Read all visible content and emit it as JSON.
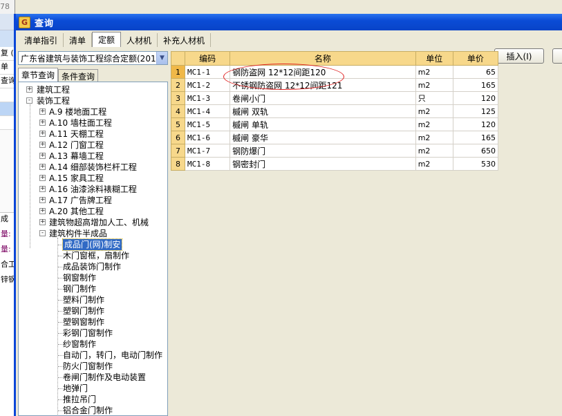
{
  "background_app": {
    "title_fragment": "78",
    "toolbar_fragment": "单",
    "left_fragment": "复 (D)",
    "row_label": "查询",
    "section_label": "成",
    "labels": [
      "量:",
      "量:",
      "合工",
      "锌钢"
    ]
  },
  "window": {
    "title": "查询",
    "icon_glyph": "G"
  },
  "tabs": [
    {
      "label": "清单指引",
      "active": false
    },
    {
      "label": "清单",
      "active": false
    },
    {
      "label": "定额",
      "active": true
    },
    {
      "label": "人材机",
      "active": false
    },
    {
      "label": "补充人材机",
      "active": false
    }
  ],
  "buttons": {
    "insert": "插入(I)"
  },
  "quota_library": {
    "selected": "广东省建筑与装饰工程综合定额(201"
  },
  "subtabs": [
    {
      "label": "章节查询",
      "active": true
    },
    {
      "label": "条件查询",
      "active": false
    }
  ],
  "tree": [
    {
      "label": "建筑工程",
      "level": 0,
      "expander": "+"
    },
    {
      "label": "装饰工程",
      "level": 0,
      "expander": "-"
    },
    {
      "label": "A.9 楼地面工程",
      "level": 1,
      "expander": "+"
    },
    {
      "label": "A.10 墙柱面工程",
      "level": 1,
      "expander": "+"
    },
    {
      "label": "A.11 天棚工程",
      "level": 1,
      "expander": "+"
    },
    {
      "label": "A.12 门窗工程",
      "level": 1,
      "expander": "+"
    },
    {
      "label": "A.13 幕墙工程",
      "level": 1,
      "expander": "+"
    },
    {
      "label": "A.14 细部装饰栏杆工程",
      "level": 1,
      "expander": "+"
    },
    {
      "label": "A.15 家具工程",
      "level": 1,
      "expander": "+"
    },
    {
      "label": "A.16 油漆涂料裱糊工程",
      "level": 1,
      "expander": "+"
    },
    {
      "label": "A.17 广告牌工程",
      "level": 1,
      "expander": "+"
    },
    {
      "label": "A.20 其他工程",
      "level": 1,
      "expander": "+"
    },
    {
      "label": "建筑物超高增加人工、机械",
      "level": 1,
      "expander": "+"
    },
    {
      "label": "建筑构件半成品",
      "level": 1,
      "expander": "-"
    },
    {
      "label": "成品门(网)制安",
      "level": 2,
      "selected": true
    },
    {
      "label": "木门窗框，扇制作",
      "level": 2
    },
    {
      "label": "成品装饰门制作",
      "level": 2
    },
    {
      "label": "钢窗制作",
      "level": 2
    },
    {
      "label": "钢门制作",
      "level": 2
    },
    {
      "label": "塑料门制作",
      "level": 2
    },
    {
      "label": "塑钢门制作",
      "level": 2
    },
    {
      "label": "塑钢窗制作",
      "level": 2
    },
    {
      "label": "彩钢门窗制作",
      "level": 2
    },
    {
      "label": "纱窗制作",
      "level": 2
    },
    {
      "label": "自动门，转门，电动门制作",
      "level": 2
    },
    {
      "label": "防火门窗制作",
      "level": 2
    },
    {
      "label": "卷闸门制作及电动装置",
      "level": 2
    },
    {
      "label": "地弹门",
      "level": 2
    },
    {
      "label": "推拉吊门",
      "level": 2
    },
    {
      "label": "铝合金门制作",
      "level": 2
    }
  ],
  "grid": {
    "columns": [
      "编码",
      "名称",
      "单位",
      "单价"
    ],
    "rows": [
      {
        "n": "1",
        "code": "MC1-1",
        "name": "钢防盗网 12*12间距120",
        "unit": "m2",
        "price": "65"
      },
      {
        "n": "2",
        "code": "MC1-2",
        "name": "不锈钢防盗网 12*12间距121",
        "unit": "m2",
        "price": "165"
      },
      {
        "n": "3",
        "code": "MC1-3",
        "name": "卷闸小门",
        "unit": "只",
        "price": "120"
      },
      {
        "n": "4",
        "code": "MC1-4",
        "name": "槭闸 双轨",
        "unit": "m2",
        "price": "125"
      },
      {
        "n": "5",
        "code": "MC1-5",
        "name": "槭闸 单轨",
        "unit": "m2",
        "price": "120"
      },
      {
        "n": "6",
        "code": "MC1-6",
        "name": "槭闸 豪华",
        "unit": "m2",
        "price": "165"
      },
      {
        "n": "7",
        "code": "MC1-7",
        "name": "钢防爆门",
        "unit": "m2",
        "price": "650"
      },
      {
        "n": "8",
        "code": "MC1-8",
        "name": "钢密封门",
        "unit": "m2",
        "price": "530"
      }
    ]
  },
  "colors": {
    "title_bar": "#0b4cd6",
    "grid_header": "#f7d88b",
    "selection": "#316ac5",
    "annotation": "#e02020"
  }
}
